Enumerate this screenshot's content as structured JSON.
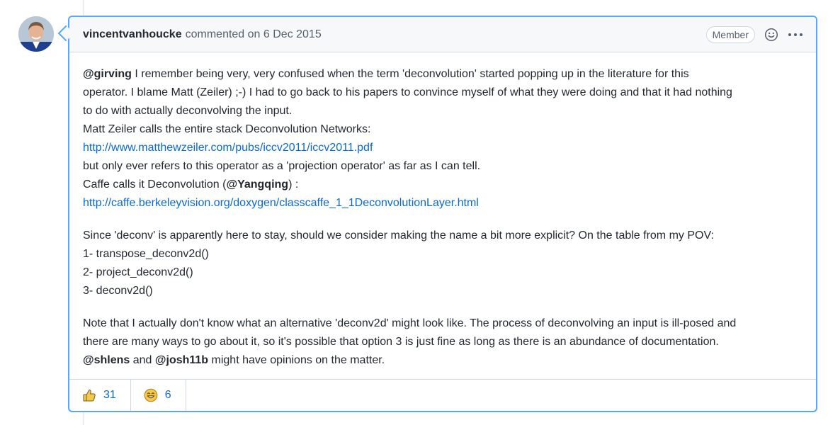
{
  "comment": {
    "author": "vincentvanhoucke",
    "meta": "commented on 6 Dec 2015",
    "badge": "Member",
    "p1": {
      "mention1": "@girving",
      "l1": " I remember being very, very confused when the term 'deconvolution' started popping up in the literature for this",
      "l2": "operator. I blame Matt (Zeiler) ;-) I had to go back to his papers to convince myself of what they were doing and that it had nothing",
      "l3": "to do with actually deconvolving the input.",
      "l4": "Matt Zeiler calls the entire stack Deconvolution Networks:",
      "link1": "http://www.matthewzeiler.com/pubs/iccv2011/iccv2011.pdf",
      "l5": "but only ever refers to this operator as a 'projection operator' as far as I can tell.",
      "l6a": "Caffe calls it Deconvolution (",
      "mention2": "@Yangqing",
      "l6b": ") :",
      "link2": "http://caffe.berkeleyvision.org/doxygen/classcaffe_1_1DeconvolutionLayer.html"
    },
    "p2": {
      "l1": "Since 'deconv' is apparently here to stay, should we consider making the name a bit more explicit? On the table from my POV:",
      "o1": "1- transpose_deconv2d()",
      "o2": "2- project_deconv2d()",
      "o3": "3- deconv2d()"
    },
    "p3": {
      "l1": "Note that I actually don't know what an alternative 'deconv2d' might look like. The process of deconvolving an input is ill-posed and",
      "l2": "there are many ways to go about it, so it's possible that option 3 is just fine as long as there is an abundance of documentation.",
      "mention1": "@shlens",
      "and": " and ",
      "mention2": "@josh11b",
      "tail": " might have opinions on the matter."
    },
    "reactions": [
      {
        "icon": "thumbs-up-icon",
        "count": "31"
      },
      {
        "icon": "smile-icon",
        "count": "6"
      }
    ]
  }
}
